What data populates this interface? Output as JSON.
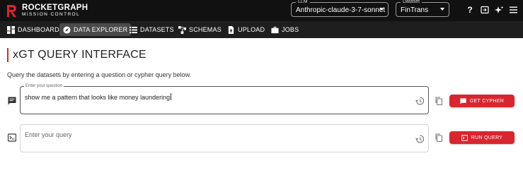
{
  "brand": {
    "name": "ROCKETGRAPH",
    "subtitle": "MISSION CONTROL",
    "accent_color": "#d9252f"
  },
  "header": {
    "llm": {
      "caption": "LLM",
      "value": "Anthropic-claude-3-7-sonnet"
    },
    "dataset": {
      "caption": "Dataset",
      "value": "FinTrans"
    },
    "icons": [
      "help-icon",
      "login-icon",
      "sparkle-icon",
      "menu-icon"
    ],
    "help_glyph": "?"
  },
  "nav": {
    "items": [
      {
        "label": "DASHBOARD",
        "icon": "dashboard-icon",
        "active": false
      },
      {
        "label": "DATA EXPLORER",
        "icon": "compass-icon",
        "active": true
      },
      {
        "label": "DATASETS",
        "icon": "list-icon",
        "active": false
      },
      {
        "label": "SCHEMAS",
        "icon": "schema-icon",
        "active": false
      },
      {
        "label": "UPLOAD",
        "icon": "upload-icon",
        "active": false
      },
      {
        "label": "JOBS",
        "icon": "briefcase-icon",
        "active": false
      }
    ]
  },
  "main": {
    "title": "xGT QUERY INTERFACE",
    "description": "Query the datasets by entering a question or cypher query below.",
    "question": {
      "label": "Enter your question",
      "value": "show me a pattern that looks like money laundering"
    },
    "query": {
      "placeholder": "Enter your query"
    },
    "get_cypher_label": "GET CYPHER",
    "run_query_label": "RUN QUERY"
  }
}
